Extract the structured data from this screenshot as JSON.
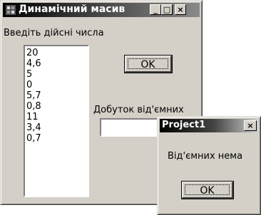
{
  "main_window": {
    "title": "Динамічний масив",
    "buttons": {
      "minimize": "_",
      "maximize": "□",
      "close": "×"
    },
    "prompt_label": "Введіть дійсні числа",
    "list_items": [
      "20",
      "4,6",
      "5",
      "0",
      "5,7",
      "0,8",
      "11",
      "3,4",
      "0,7"
    ],
    "ok_label": "OK",
    "product_label": "Добуток від'ємних",
    "result_value": ""
  },
  "dialog": {
    "title": "Project1",
    "close_label": "×",
    "message": "Від'ємних нема",
    "ok_label": "OK"
  }
}
